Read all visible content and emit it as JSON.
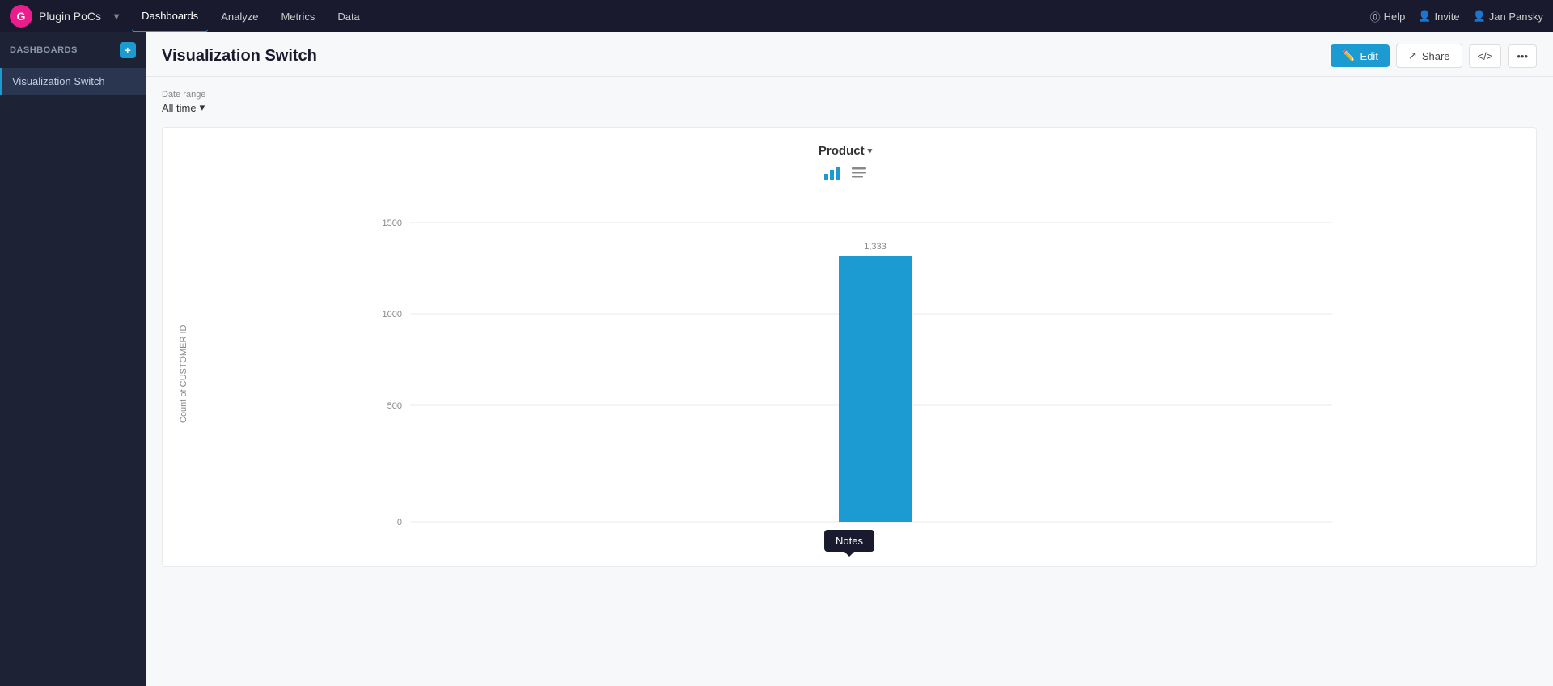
{
  "app": {
    "logo_icon": "G",
    "name": "Plugin PoCs",
    "chevron": "▾"
  },
  "nav": {
    "tabs": [
      {
        "id": "dashboards",
        "label": "Dashboards",
        "active": true
      },
      {
        "id": "analyze",
        "label": "Analyze",
        "active": false
      },
      {
        "id": "metrics",
        "label": "Metrics",
        "active": false
      },
      {
        "id": "data",
        "label": "Data",
        "active": false
      }
    ],
    "right": [
      {
        "id": "help",
        "label": "Help",
        "icon": "?"
      },
      {
        "id": "invite",
        "label": "Invite",
        "icon": "👤"
      },
      {
        "id": "user",
        "label": "Jan Pansky",
        "icon": "👤"
      }
    ]
  },
  "sidebar": {
    "header": "DASHBOARDS",
    "add_label": "+",
    "items": [
      {
        "id": "visualization-switch",
        "label": "Visualization Switch",
        "active": true
      }
    ]
  },
  "main": {
    "title": "Visualization Switch",
    "actions": {
      "edit_label": "Edit",
      "share_label": "Share",
      "code_label": "</>",
      "more_label": "•••"
    }
  },
  "filters": {
    "date_range_label": "Date range",
    "date_range_value": "All time",
    "chevron": "▾"
  },
  "chart": {
    "product_label": "Product",
    "product_chevron": "▾",
    "y_axis_label": "Count of CUSTOMER ID",
    "y_axis_ticks": [
      "1500",
      "1000",
      "500",
      "0"
    ],
    "bar_value": "1,333",
    "bar_color": "#1b9bd1",
    "chart_types": [
      {
        "id": "bar",
        "label": "Bar chart",
        "active": true
      },
      {
        "id": "table",
        "label": "Table chart",
        "active": false
      }
    ]
  },
  "notes": {
    "label": "Notes"
  }
}
